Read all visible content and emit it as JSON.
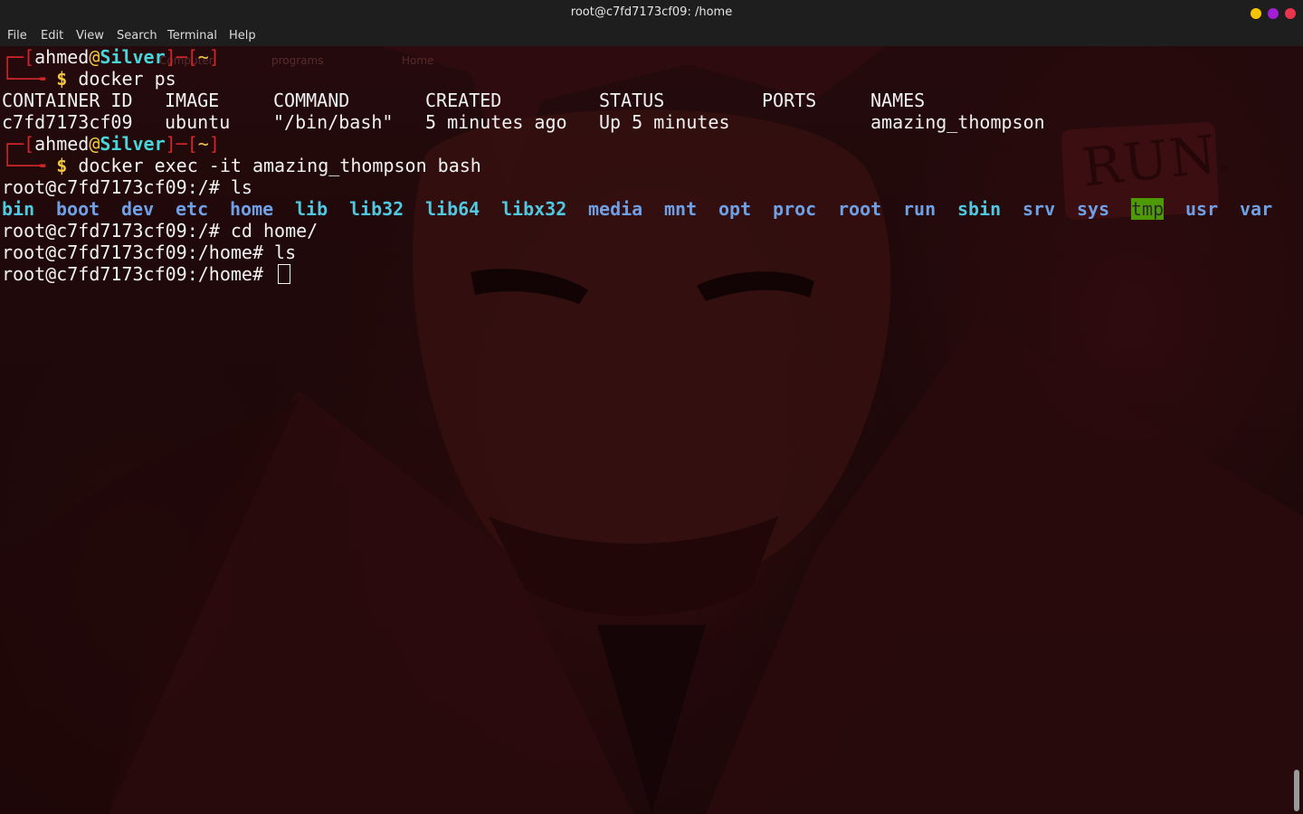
{
  "window": {
    "title": "root@c7fd7173cf09: /home",
    "controls": {
      "minimize_color": "#f5c400",
      "maximize_color": "#a21fd6",
      "close_color": "#e8344c"
    }
  },
  "menu": [
    "File",
    "Edit",
    "View",
    "Search",
    "Terminal",
    "Help"
  ],
  "background": {
    "watermark_labels": [
      "programs",
      "Home"
    ],
    "sign_text": "RUN."
  },
  "prompt1": {
    "top_open": "┌─[",
    "user": "ahmed",
    "at": "@",
    "host": "Silver",
    "mid": "]─[",
    "dir": "~",
    "close": "]",
    "bottom": "└──╼",
    "dollar": "$",
    "command": "docker ps"
  },
  "docker_ps": {
    "headers": [
      "CONTAINER ID",
      "IMAGE",
      "COMMAND",
      "CREATED",
      "STATUS",
      "PORTS",
      "NAMES"
    ],
    "row": [
      "c7fd7173cf09",
      "ubuntu",
      "\"/bin/bash\"",
      "5 minutes ago",
      "Up 5 minutes",
      "",
      "amazing_thompson"
    ]
  },
  "prompt2": {
    "top_open": "┌─[",
    "user": "ahmed",
    "at": "@",
    "host": "Silver",
    "mid": "]─[",
    "dir": "~",
    "close": "]",
    "bottom": "└──╼",
    "dollar": "$",
    "command": "docker exec -it amazing_thompson bash"
  },
  "lines": {
    "ls_root_cmd": "root@c7fd7173cf09:/# ls",
    "cd_cmd": "root@c7fd7173cf09:/# cd home/",
    "ls_home_cmd": "root@c7fd7173cf09:/home# ls",
    "current_prompt": "root@c7fd7173cf09:/home# "
  },
  "ls_output": [
    {
      "name": "bin",
      "kind": "link"
    },
    {
      "name": "boot",
      "kind": "dir"
    },
    {
      "name": "dev",
      "kind": "dir"
    },
    {
      "name": "etc",
      "kind": "dir"
    },
    {
      "name": "home",
      "kind": "dir"
    },
    {
      "name": "lib",
      "kind": "link"
    },
    {
      "name": "lib32",
      "kind": "link"
    },
    {
      "name": "lib64",
      "kind": "link"
    },
    {
      "name": "libx32",
      "kind": "link"
    },
    {
      "name": "media",
      "kind": "dir"
    },
    {
      "name": "mnt",
      "kind": "dir"
    },
    {
      "name": "opt",
      "kind": "dir"
    },
    {
      "name": "proc",
      "kind": "dir"
    },
    {
      "name": "root",
      "kind": "dir"
    },
    {
      "name": "run",
      "kind": "dir"
    },
    {
      "name": "sbin",
      "kind": "link"
    },
    {
      "name": "srv",
      "kind": "dir"
    },
    {
      "name": "sys",
      "kind": "dir"
    },
    {
      "name": "tmp",
      "kind": "sticky"
    },
    {
      "name": "usr",
      "kind": "dir"
    },
    {
      "name": "var",
      "kind": "dir"
    }
  ]
}
